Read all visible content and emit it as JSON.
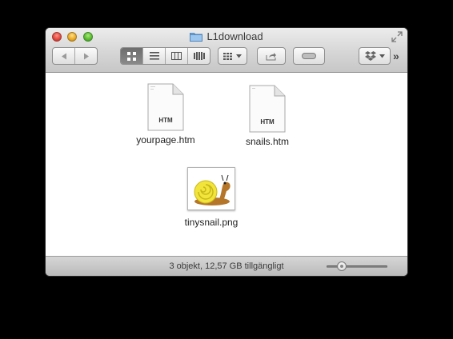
{
  "window": {
    "title": "L1download"
  },
  "toolbar": {
    "back_icon": "back-arrow-icon",
    "forward_icon": "forward-arrow-icon",
    "view_modes": [
      "icon-view",
      "list-view",
      "column-view",
      "coverflow-view"
    ],
    "active_view": "icon-view",
    "arrange_icon": "arrange-grid-icon",
    "share_icon": "share-icon",
    "tag_icon": "label-icon",
    "dropbox_icon": "dropbox-icon",
    "overflow": "»"
  },
  "files": [
    {
      "name": "yourpage.htm",
      "type_label": "HTM"
    },
    {
      "name": "snails.htm",
      "type_label": "HTM"
    },
    {
      "name": "tinysnail.png",
      "type_label": ""
    }
  ],
  "status": {
    "text": "3 objekt, 12,57 GB tillgängligt",
    "icon_size_level": 0.25
  },
  "colors": {
    "window_chrome": "#d4d4d4",
    "active_segment": "#6d6d6d",
    "snail_shell": "#f2e43a",
    "snail_body": "#b5762a"
  }
}
